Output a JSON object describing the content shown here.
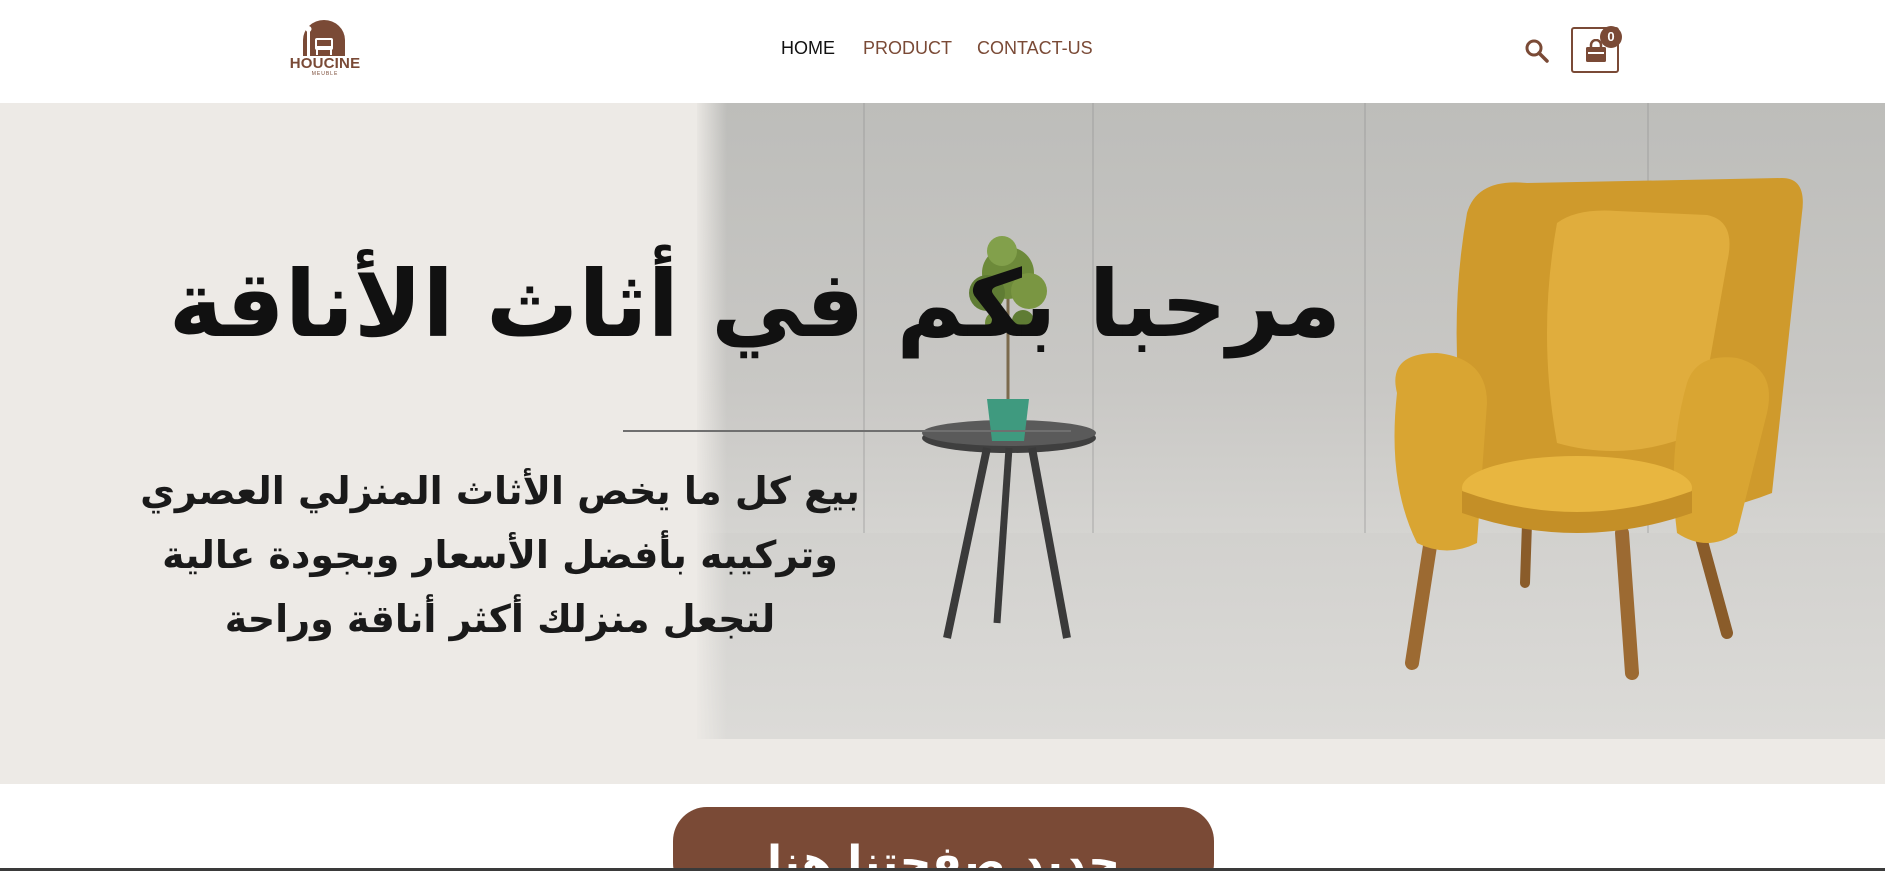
{
  "header": {
    "logo": {
      "name": "HOUCINE",
      "sub": "MEUBLE"
    },
    "nav": [
      {
        "label": "HOME"
      },
      {
        "label": "PRODUCT"
      },
      {
        "label": "CONTACT-US"
      }
    ],
    "search_icon": "search-icon",
    "cart": {
      "icon": "shopping-bag-icon",
      "count": "0"
    }
  },
  "hero": {
    "title": "مرحبا بكم في أثاث الأناقة",
    "description_lines": [
      "بيع كل ما يخص الأثاث المنزلي العصري",
      "وتركيبه بأفضل الأسعار وبجودة عالية",
      "لتجعل منزلك أكثر أناقة وراحة"
    ],
    "image": "yellow-armchair-with-side-table-photo"
  },
  "cta": {
    "label": "جديد صفحتنا هنا"
  },
  "colors": {
    "brand": "#7a4a36",
    "hero_bg": "#edeae6",
    "text": "#111111",
    "chair": "#d9a532"
  }
}
